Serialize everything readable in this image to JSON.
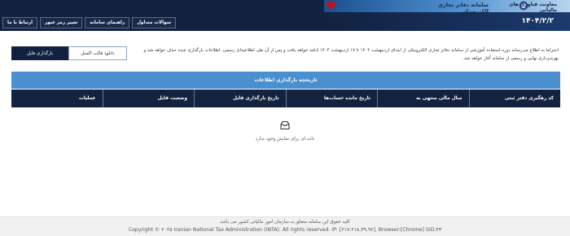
{
  "header": {
    "brand_title": "سامانه دفاتر تجاری الکترونیکی",
    "brand_subtitle": "معاونت فناوری های مالیاتی",
    "date": "۱۴۰۴/۲/۲",
    "nav": [
      {
        "label": "سوالات متداول"
      },
      {
        "label": "راهنمای سامانه"
      },
      {
        "label": "تغییر رمز عبور"
      },
      {
        "label": "ارتباط با ما"
      }
    ]
  },
  "notice": {
    "text": "احتراما به اطلاع می‌رساند دوره استفاده آموزشی از سامانه دفاتر تجاری الکترونیکی از ابتدای اردیبهشت ۱۴۰۴ تا ۱۷ اردیبهشت ۱۴۰۴ ادامه خواهد یافت و پس از آن طی اطلاعیه‌ای رسمی، اطلاعات بارگذاری شده حذف خواهد شد و بهره‌برداری نهایی و رسمی از سامانه آغاز خواهد شد."
  },
  "actions": {
    "upload_label": "بارگذاری فایل",
    "excel_label": "دانلود قالب اکسل"
  },
  "table": {
    "title": "تاریخچه بارگذاری اطلاعات",
    "columns": [
      "کد رهگیری دفتر ثبتی",
      "سال مالی منتهی به",
      "تاریخ مانده حساب‌ها",
      "تاریخ بارگذاری فایل",
      "وضعیت فایل",
      "عملیات"
    ],
    "empty_text": "داده ای برای نمایش وجود ندارد"
  },
  "footer": {
    "rights_fa": "کلیه حقوق این سامانه متعلق به سازمان امور مالیاتی کشور می باشد",
    "rights_en": "Copyright © ۲۰۲۵ Iranian National Tax Administration (INTA). All rights reserved. IP: [۲۱۷.۲۱۸.۳۹.۹۲], Browser:[Chrome] SID:۴۳"
  },
  "colors": {
    "navy": "#12213f",
    "table_title": "#4a8fcf"
  }
}
